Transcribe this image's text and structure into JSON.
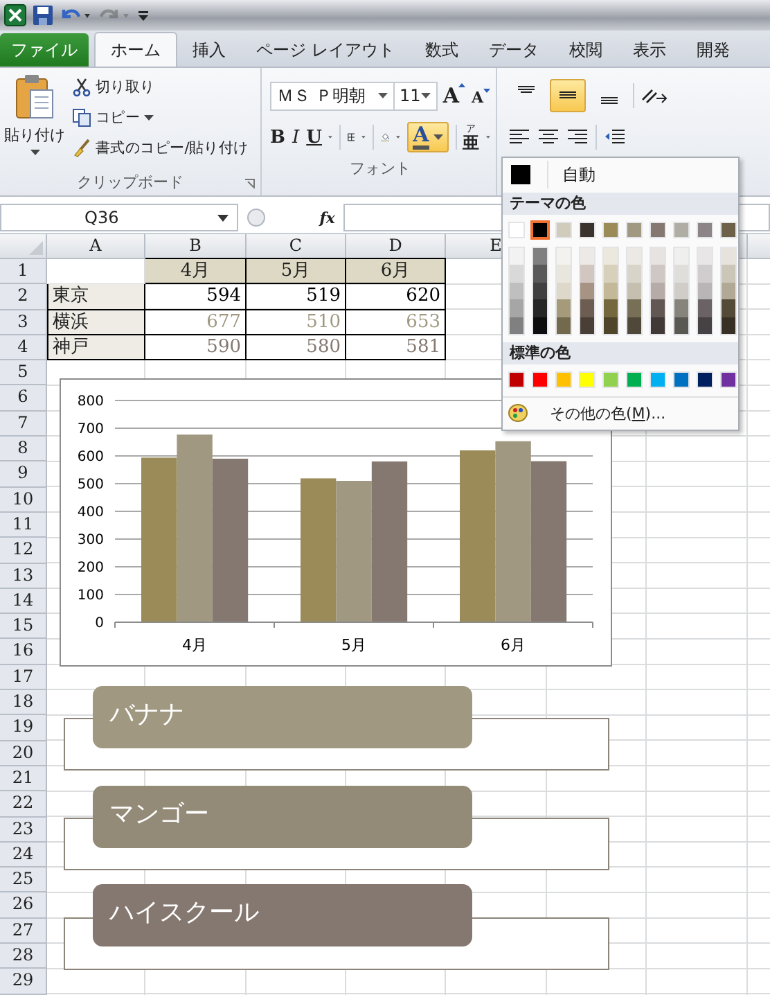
{
  "quick_access": [
    {
      "kind": "logo",
      "disabled": false
    },
    {
      "kind": "save",
      "disabled": false
    },
    {
      "kind": "undo",
      "disabled": false
    },
    {
      "kind": "redo",
      "disabled": true
    },
    {
      "kind": "customize",
      "disabled": false
    }
  ],
  "tabs": [
    {
      "label": "ファイル",
      "kind": "file",
      "selected": false
    },
    {
      "label": "ホーム",
      "kind": "tab",
      "selected": true
    },
    {
      "label": "挿入",
      "kind": "tab",
      "selected": false
    },
    {
      "label": "ページ レイアウト",
      "kind": "tab",
      "selected": false
    },
    {
      "label": "数式",
      "kind": "tab",
      "selected": false
    },
    {
      "label": "データ",
      "kind": "tab",
      "selected": false
    },
    {
      "label": "校閲",
      "kind": "tab",
      "selected": false
    },
    {
      "label": "表示",
      "kind": "tab",
      "selected": false
    },
    {
      "label": "開発",
      "kind": "tab",
      "selected": false
    }
  ],
  "ribbon": {
    "clipboard": {
      "paste": "貼り付け",
      "cut": "切り取り",
      "copy": "コピー",
      "format_painter": "書式のコピー/貼り付け",
      "label": "クリップボード"
    },
    "font": {
      "name": "ＭＳ Ｐ明朝",
      "size": "11",
      "grow": "A",
      "shrink": "A",
      "bold": "B",
      "italic": "I",
      "underline": "U",
      "font_color": "A",
      "font_color_active": true,
      "phonetic_ruby": "ア",
      "phonetic_base": "亜",
      "label": "フォント"
    },
    "alignment": {
      "vertical": [
        {
          "selected": false
        },
        {
          "selected": true
        },
        {
          "selected": false
        }
      ]
    }
  },
  "formula_bar": {
    "name_box": "Q36",
    "fx": "fx"
  },
  "sheet": {
    "columns": [
      "A",
      "B",
      "C",
      "D",
      "E"
    ],
    "rows": [
      "1",
      "2",
      "3",
      "4",
      "5",
      "6",
      "7",
      "8",
      "9",
      "10",
      "11",
      "12",
      "13",
      "14",
      "15",
      "16",
      "17",
      "18",
      "19",
      "20",
      "21",
      "22",
      "23",
      "24",
      "25",
      "26",
      "27",
      "28",
      "29"
    ],
    "header_row": [
      "4月",
      "5月",
      "6月"
    ],
    "data_rows": [
      {
        "label": "東京",
        "values": [
          "594",
          "519",
          "620"
        ],
        "color": "#000000"
      },
      {
        "label": "横浜",
        "values": [
          "677",
          "510",
          "653"
        ],
        "color": "#a09880"
      },
      {
        "label": "神戸",
        "values": [
          "590",
          "580",
          "581"
        ],
        "color": "#857870"
      }
    ]
  },
  "chart": {
    "chart_data": {
      "type": "bar",
      "categories": [
        "4月",
        "5月",
        "6月"
      ],
      "series": [
        {
          "color": "#9b8b58",
          "values": [
            594,
            519,
            620
          ]
        },
        {
          "color": "#a09880",
          "values": [
            677,
            510,
            653
          ]
        },
        {
          "color": "#857870",
          "values": [
            590,
            580,
            581
          ]
        }
      ],
      "grid": true,
      "ylim": [
        0,
        800
      ],
      "yticks": [
        0,
        100,
        200,
        300,
        400,
        500,
        600,
        700,
        800
      ]
    }
  },
  "shapes": [
    {
      "label": "バナナ",
      "color": "#a09880"
    },
    {
      "label": "マンゴー",
      "color": "#938a77"
    },
    {
      "label": "ハイスクール",
      "color": "#857870"
    }
  ],
  "color_menu": {
    "automatic": "自動",
    "theme_heading": "テーマの色",
    "theme_colors": [
      {
        "color": "#ffffff",
        "selected": false,
        "shades": [
          {
            "color": "#f2f2f2"
          },
          {
            "color": "#d9d9d9"
          },
          {
            "color": "#bfbfbf"
          },
          {
            "color": "#a6a6a6"
          },
          {
            "color": "#808080"
          }
        ]
      },
      {
        "color": "#000000",
        "selected": true,
        "shades": [
          {
            "color": "#7f7f7f"
          },
          {
            "color": "#595959"
          },
          {
            "color": "#404040"
          },
          {
            "color": "#262626"
          },
          {
            "color": "#0d0d0d"
          }
        ]
      },
      {
        "color": "#d1cbbb",
        "selected": false,
        "shades": [
          {
            "color": "#f4f2ee"
          },
          {
            "color": "#e9e6dd"
          },
          {
            "color": "#ddd8ca"
          },
          {
            "color": "#a59a79"
          },
          {
            "color": "#736a4d"
          }
        ]
      },
      {
        "color": "#3a322c",
        "selected": false,
        "shades": [
          {
            "color": "#ede9e6"
          },
          {
            "color": "#d2c7c0"
          },
          {
            "color": "#a69384"
          },
          {
            "color": "#6d5c51"
          },
          {
            "color": "#4a3f37"
          }
        ]
      },
      {
        "color": "#9b8b58",
        "selected": false,
        "shades": [
          {
            "color": "#ebe8dd"
          },
          {
            "color": "#d7d0bb"
          },
          {
            "color": "#c3b898"
          },
          {
            "color": "#75683f"
          },
          {
            "color": "#4e452a"
          }
        ]
      },
      {
        "color": "#a09880",
        "selected": false,
        "shades": [
          {
            "color": "#ece9e4"
          },
          {
            "color": "#d8d4ca"
          },
          {
            "color": "#c5bfaf"
          },
          {
            "color": "#786f57"
          },
          {
            "color": "#50493a"
          }
        ]
      },
      {
        "color": "#857870",
        "selected": false,
        "shades": [
          {
            "color": "#e7e3e1"
          },
          {
            "color": "#cec7c3"
          },
          {
            "color": "#b6aba6"
          },
          {
            "color": "#625752"
          },
          {
            "color": "#413936"
          }
        ]
      },
      {
        "color": "#b0ada5",
        "selected": false,
        "shades": [
          {
            "color": "#efefed"
          },
          {
            "color": "#dfdedb"
          },
          {
            "color": "#d0cdc9"
          },
          {
            "color": "#86847c"
          },
          {
            "color": "#595852"
          }
        ]
      },
      {
        "color": "#8c8486",
        "selected": false,
        "shades": [
          {
            "color": "#e8e6e7"
          },
          {
            "color": "#d1cdce"
          },
          {
            "color": "#b9b4b5"
          },
          {
            "color": "#6a6264"
          },
          {
            "color": "#464143"
          }
        ]
      },
      {
        "color": "#6e6149",
        "selected": false,
        "shades": [
          {
            "color": "#e6e3dc"
          },
          {
            "color": "#cbc6b8"
          },
          {
            "color": "#b1a996"
          },
          {
            "color": "#534a37"
          },
          {
            "color": "#372f24"
          }
        ]
      }
    ],
    "standard_heading": "標準の色",
    "standard_colors": [
      {
        "color": "#c00000"
      },
      {
        "color": "#ff0000"
      },
      {
        "color": "#ffc000"
      },
      {
        "color": "#ffff00"
      },
      {
        "color": "#92d050"
      },
      {
        "color": "#00b050"
      },
      {
        "color": "#00b0f0"
      },
      {
        "color": "#0070c0"
      },
      {
        "color": "#002060"
      },
      {
        "color": "#7030a0"
      }
    ],
    "more_colors": {
      "before": "その他の色(",
      "key": "M",
      "after": ")..."
    }
  }
}
